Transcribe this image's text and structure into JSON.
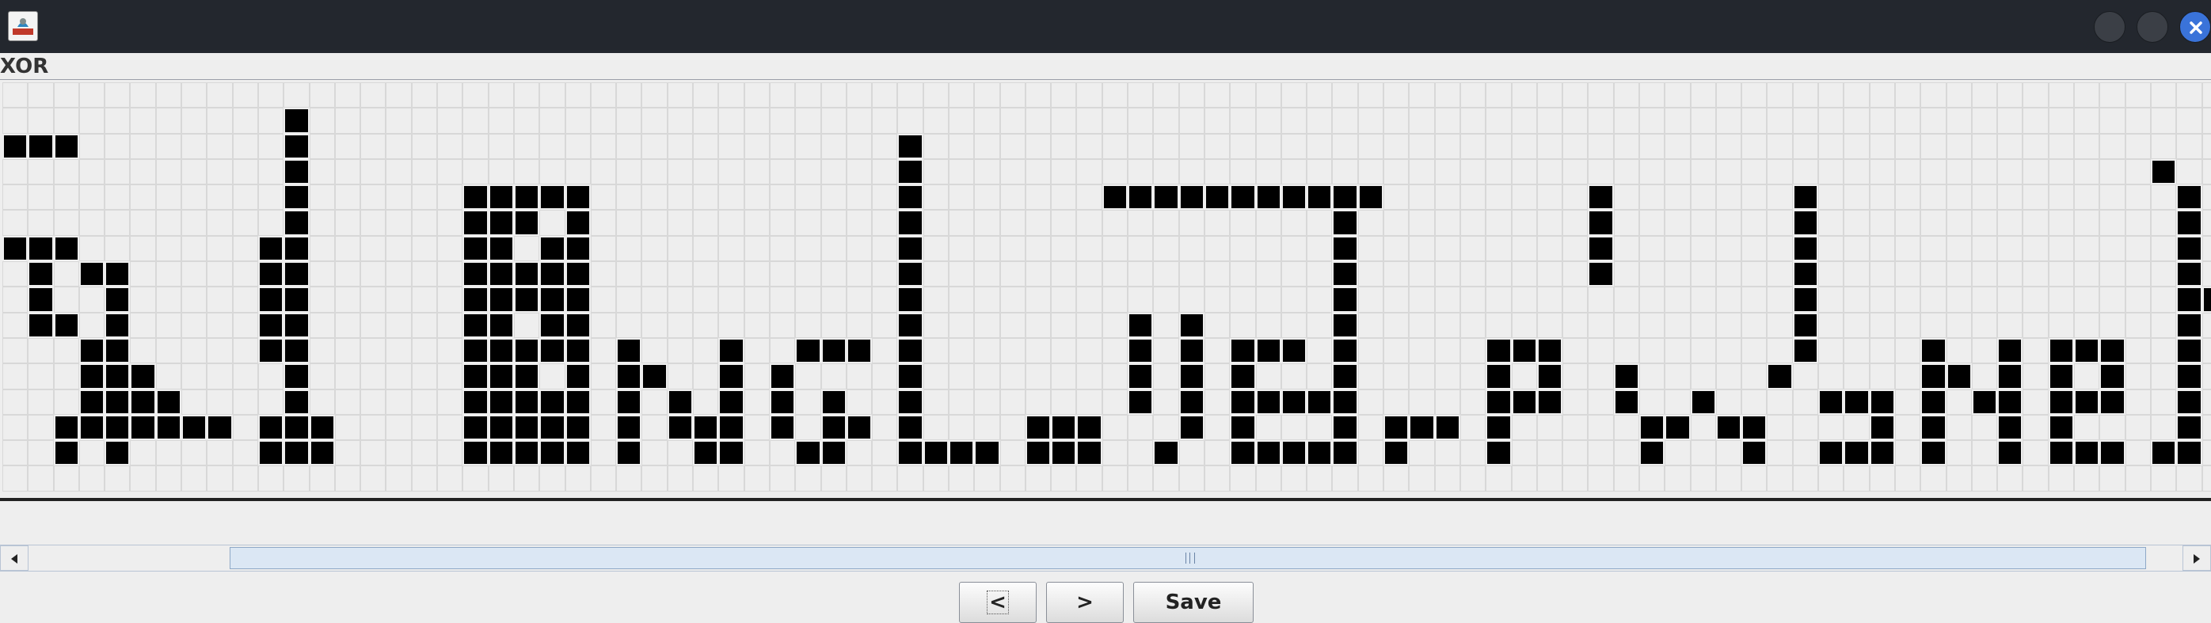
{
  "window": {
    "icon": "java-app-icon",
    "controls": [
      "minimize-icon",
      "maximize-icon",
      "close-icon"
    ],
    "accent": "#3a73d9"
  },
  "panel": {
    "label": "XOR"
  },
  "grid": {
    "columns": 87,
    "rows": 16,
    "cell_on_color": "#000000",
    "cell_off_color": "#eeeeee",
    "filled": {
      "0": [
        2,
        6
      ],
      "1": [
        2,
        6,
        7,
        8,
        9
      ],
      "2": [
        2,
        6,
        9,
        13,
        14
      ],
      "3": [
        7,
        10,
        11,
        12,
        13
      ],
      "4": [
        7,
        8,
        9,
        10,
        11,
        12,
        13,
        14
      ],
      "5": [
        11,
        12,
        13
      ],
      "6": [
        12,
        13
      ],
      "7": [
        13
      ],
      "8": [
        13
      ],
      "9": [],
      "10": [
        6,
        7,
        8,
        9,
        10,
        13,
        14
      ],
      "11": [
        1,
        2,
        3,
        4,
        5,
        6,
        7,
        8,
        9,
        10,
        11,
        12,
        13,
        14
      ],
      "12": [
        13,
        14
      ],
      "13": [],
      "14": [],
      "15": [],
      "16": [],
      "17": [],
      "18": [
        4,
        5,
        6,
        7,
        8,
        9,
        10,
        11,
        12,
        13,
        14
      ],
      "19": [
        4,
        5,
        6,
        7,
        8,
        9,
        10,
        11,
        12,
        13,
        14
      ],
      "20": [
        4,
        5,
        7,
        8,
        10,
        11,
        12,
        13,
        14
      ],
      "21": [
        4,
        6,
        7,
        8,
        9,
        10,
        12,
        13,
        14
      ],
      "22": [
        4,
        5,
        6,
        7,
        8,
        9,
        10,
        11,
        12,
        13,
        14
      ],
      "23": [],
      "24": [
        10,
        11,
        12,
        13,
        14
      ],
      "25": [
        11
      ],
      "26": [
        12,
        13
      ],
      "27": [
        13,
        14
      ],
      "28": [
        10,
        11,
        12,
        13,
        14
      ],
      "29": [],
      "30": [
        11,
        12,
        13
      ],
      "31": [
        10,
        14
      ],
      "32": [
        10,
        12,
        13,
        14
      ],
      "33": [
        10,
        13
      ],
      "34": [],
      "35": [
        2,
        3,
        4,
        5,
        6,
        7,
        8,
        9,
        10,
        11,
        12,
        13,
        14
      ],
      "36": [
        14
      ],
      "37": [
        14
      ],
      "38": [
        14
      ],
      "39": [],
      "40": [
        13,
        14
      ],
      "41": [
        13,
        14
      ],
      "42": [
        13,
        14
      ],
      "43": [
        4
      ],
      "44": [
        4,
        9,
        10,
        11,
        12
      ],
      "45": [
        4,
        14
      ],
      "46": [
        4,
        9,
        10,
        11,
        12,
        13
      ],
      "47": [
        4
      ],
      "48": [
        4,
        10,
        11,
        12,
        13,
        14
      ],
      "49": [
        4,
        10,
        12,
        14
      ],
      "50": [
        4,
        10,
        12,
        14
      ],
      "51": [
        4,
        12,
        14
      ],
      "52": [
        4,
        5,
        6,
        7,
        8,
        9,
        10,
        11,
        12,
        13,
        14
      ],
      "53": [
        4
      ],
      "54": [
        13,
        14
      ],
      "55": [
        13
      ],
      "56": [
        13
      ],
      "57": [],
      "58": [
        10,
        11,
        12,
        13,
        14
      ],
      "59": [
        10,
        12
      ],
      "60": [
        10,
        11,
        12
      ],
      "61": [],
      "62": [
        4,
        5,
        6,
        7
      ],
      "63": [
        11,
        12
      ],
      "64": [
        13,
        14
      ],
      "65": [
        13
      ],
      "66": [
        12
      ],
      "67": [
        13
      ],
      "68": [
        13,
        14
      ],
      "69": [
        11
      ],
      "70": [
        4,
        5,
        6,
        7,
        8,
        9,
        10
      ],
      "71": [
        12,
        14
      ],
      "72": [
        12,
        14
      ],
      "73": [
        12,
        13,
        14
      ],
      "74": [],
      "75": [
        10,
        11,
        12,
        13,
        14
      ],
      "76": [
        11
      ],
      "77": [
        12
      ],
      "78": [
        10,
        11,
        12,
        13,
        14
      ],
      "79": [],
      "80": [
        10,
        11,
        12,
        13,
        14
      ],
      "81": [
        10,
        12,
        14
      ],
      "82": [
        10,
        11,
        12,
        14
      ],
      "83": [],
      "84": [
        3,
        14
      ],
      "85": [
        4,
        5,
        6,
        7,
        8,
        9,
        10,
        11,
        12,
        13,
        14
      ],
      "86": [
        8
      ]
    }
  },
  "scrollbar": {
    "left_arrow": "scroll-left-icon",
    "right_arrow": "scroll-right-icon",
    "thumb_grip": "grip-icon"
  },
  "buttons": {
    "prev_label": "<",
    "next_label": ">",
    "save_label": "Save"
  }
}
